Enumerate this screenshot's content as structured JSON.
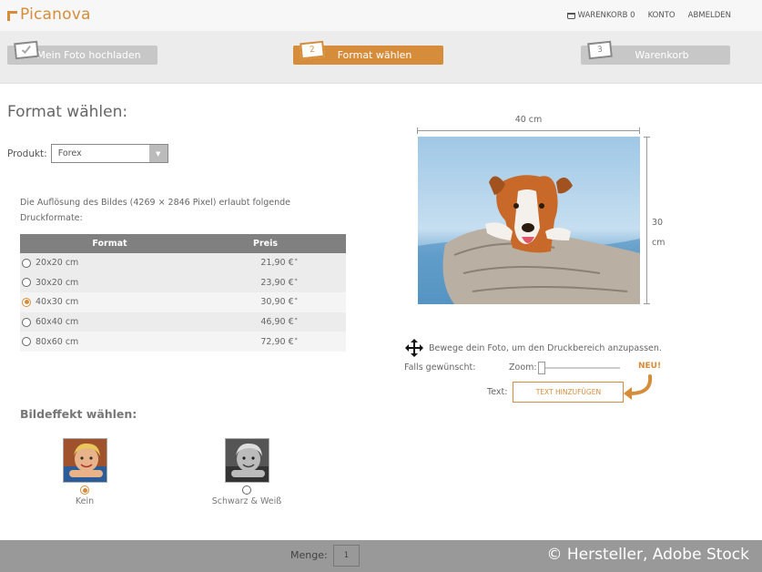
{
  "header": {
    "logo_text": "Picanova",
    "nav": [
      "WARENKORB 0",
      "KONTO",
      "ABMELDEN"
    ]
  },
  "steps": [
    {
      "number": "",
      "label": "Mein Foto hochladen",
      "state": "done"
    },
    {
      "number": "2",
      "label": "Format wählen",
      "state": "active"
    },
    {
      "number": "3",
      "label": "Warenkorb",
      "state": "todo"
    }
  ],
  "main": {
    "title": "Format wählen:",
    "product_label": "Produkt:",
    "product_value": "Forex",
    "intro": "Die Auflösung des Bildes (4269 × 2846 Pixel) erlaubt folgende Druckformate:",
    "table": {
      "headers": [
        "Format",
        "Preis"
      ],
      "rows": [
        {
          "format": "20x20 cm",
          "price": "21,90 €",
          "mark": "*",
          "selected": false
        },
        {
          "format": "30x20 cm",
          "price": "23,90 €",
          "mark": "*",
          "selected": false
        },
        {
          "format": "40x30 cm",
          "price": "30,90 €",
          "mark": "*",
          "selected": true
        },
        {
          "format": "60x40 cm",
          "price": "46,90 €",
          "mark": "*",
          "selected": false
        },
        {
          "format": "80x60 cm",
          "price": "72,90 €",
          "mark": "*",
          "selected": false
        }
      ]
    },
    "effects_title": "Bildeffekt wählen:",
    "effects": [
      {
        "label": "Kein",
        "selected": true
      },
      {
        "label": "Schwarz & Weiß",
        "selected": false
      }
    ]
  },
  "preview": {
    "width_label": "40 cm",
    "height_value": "30",
    "height_unit": "cm",
    "move_hint": "Bewege dein Foto, um den Druckbereich anzupassen.",
    "falls_label": "Falls gewünscht:",
    "zoom_label": "Zoom:",
    "new_badge": "NEU!",
    "text_label": "Text:",
    "text_button": "TEXT HINZUFÜGEN"
  },
  "footer": {
    "qty_label": "Menge:",
    "qty_value": "1",
    "copyright": "© Hersteller, Adobe Stock"
  },
  "colors": {
    "accent": "#d58d3b",
    "step_inactive": "#c7c7c7",
    "table_header": "#808080",
    "footer": "#999999"
  }
}
